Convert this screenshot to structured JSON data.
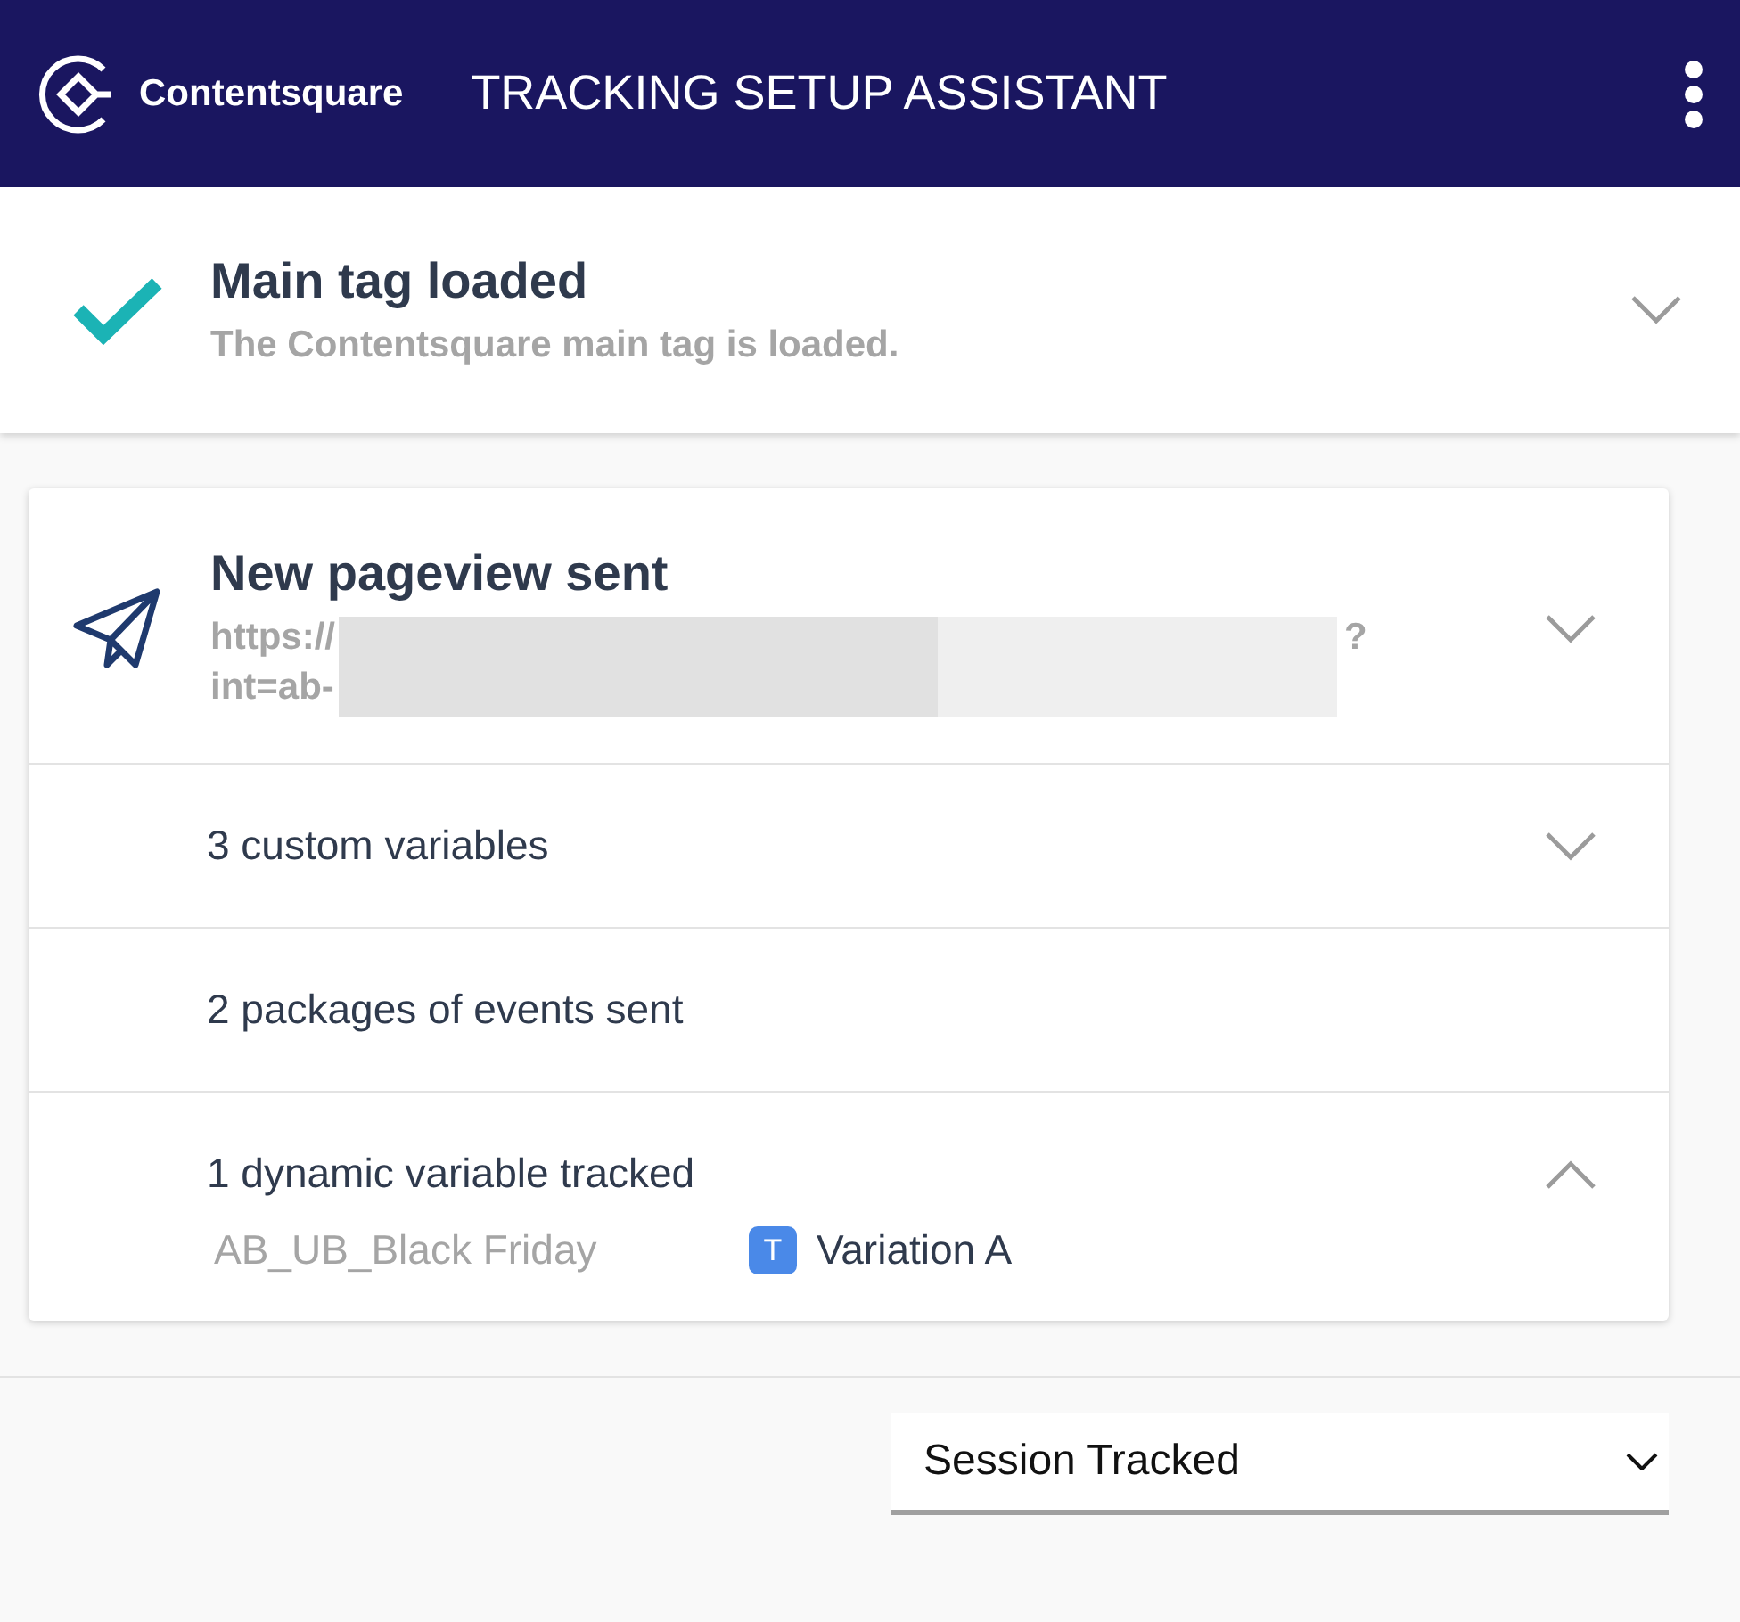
{
  "header": {
    "brand": "Contentsquare",
    "title": "TRACKING SETUP ASSISTANT"
  },
  "main_tag": {
    "title": "Main tag loaded",
    "subtitle": "The Contentsquare main tag is loaded.",
    "expanded": false
  },
  "pageview": {
    "title": "New pageview sent",
    "url_line_1": {
      "start": "https://",
      "end": "?"
    },
    "url_line_2": {
      "start": "int=ab-"
    },
    "expanded": false,
    "rows": [
      {
        "label": "3 custom variables",
        "expanded": false
      },
      {
        "label": "2 packages of events sent"
      },
      {
        "label": "1 dynamic variable tracked",
        "expanded": true,
        "variables": [
          {
            "name": "AB_UB_Black Friday",
            "type_badge": "T",
            "value": "Variation A"
          }
        ]
      }
    ]
  },
  "footer": {
    "select": {
      "value": "Session Tracked"
    }
  }
}
